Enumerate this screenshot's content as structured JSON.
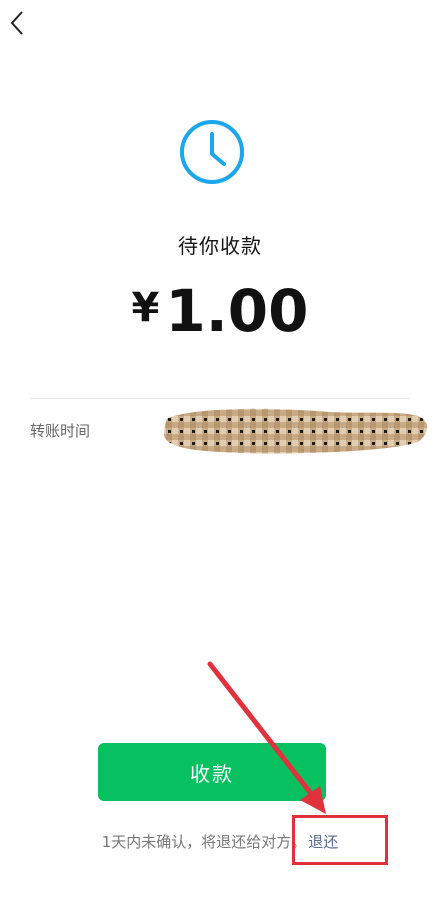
{
  "nav": {
    "back_icon": "chevron-left-icon"
  },
  "status": {
    "icon": "clock-icon",
    "icon_color": "#1aa7ec",
    "title": "待你收款"
  },
  "amount": {
    "currency": "¥",
    "value": "1.00"
  },
  "details": {
    "transfer_time_label": "转账时间"
  },
  "actions": {
    "collect_label": "收款",
    "collect_color": "#07c160"
  },
  "footer": {
    "note": "1天内未确认，将退还给对方。",
    "return_link": "退还",
    "link_color": "#576b95"
  },
  "annotation": {
    "color": "#e0323d"
  }
}
